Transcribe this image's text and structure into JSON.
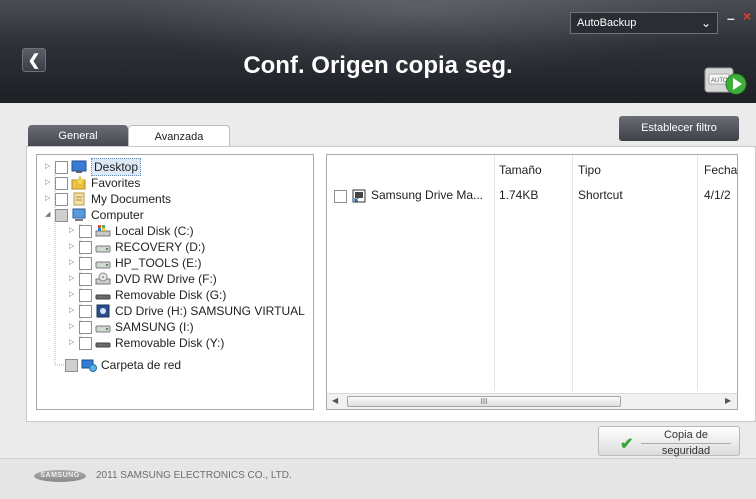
{
  "header": {
    "title": "Conf. Origen copia seg.",
    "mode_selected": "AutoBackup",
    "back_icon": "back-arrow-icon",
    "minimize_label": "–",
    "close_label": "×",
    "accent_color": "#e5402a"
  },
  "tabs": [
    {
      "label": "General",
      "active": false
    },
    {
      "label": "Avanzada",
      "active": true
    }
  ],
  "filter_button_label": "Establecer filtro",
  "tree": [
    {
      "label": "Desktop",
      "icon": "desktop-icon",
      "level": 0,
      "selected": true
    },
    {
      "label": "Favorites",
      "icon": "favorites-star-icon",
      "level": 0
    },
    {
      "label": "My Documents",
      "icon": "documents-icon",
      "level": 0
    },
    {
      "label": "Computer",
      "icon": "computer-icon",
      "level": 0,
      "expanded": true
    },
    {
      "label": "Local Disk (C:)",
      "icon": "local-disk-icon",
      "level": 1
    },
    {
      "label": "RECOVERY (D:)",
      "icon": "drive-icon",
      "level": 1
    },
    {
      "label": "HP_TOOLS (E:)",
      "icon": "drive-icon",
      "level": 1
    },
    {
      "label": "DVD RW Drive (F:)",
      "icon": "dvd-drive-icon",
      "level": 1
    },
    {
      "label": "Removable Disk (G:)",
      "icon": "removable-disk-icon",
      "level": 1
    },
    {
      "label": "CD Drive (H:) SAMSUNG VIRTUAL",
      "icon": "cd-drive-icon",
      "level": 1
    },
    {
      "label": "SAMSUNG (I:)",
      "icon": "drive-icon",
      "level": 1
    },
    {
      "label": "Removable Disk (Y:)",
      "icon": "removable-disk-icon",
      "level": 1
    },
    {
      "label": "Carpeta de red",
      "icon": "network-folder-icon",
      "level": 0
    }
  ],
  "file_list": {
    "columns": [
      "",
      "Tamaño",
      "Tipo",
      "Fecha"
    ],
    "rows": [
      {
        "name": "Samsung Drive Ma...",
        "size": "1.74KB",
        "type": "Shortcut",
        "date": "4/1/2"
      }
    ],
    "scroll_thumb_label": "III"
  },
  "backup_button": {
    "line1": "Copia de",
    "line2": "seguridad"
  },
  "footer": {
    "logo_text": "SAMSUNG",
    "copyright": "2011 SAMSUNG ELECTRONICS CO., LTD."
  }
}
